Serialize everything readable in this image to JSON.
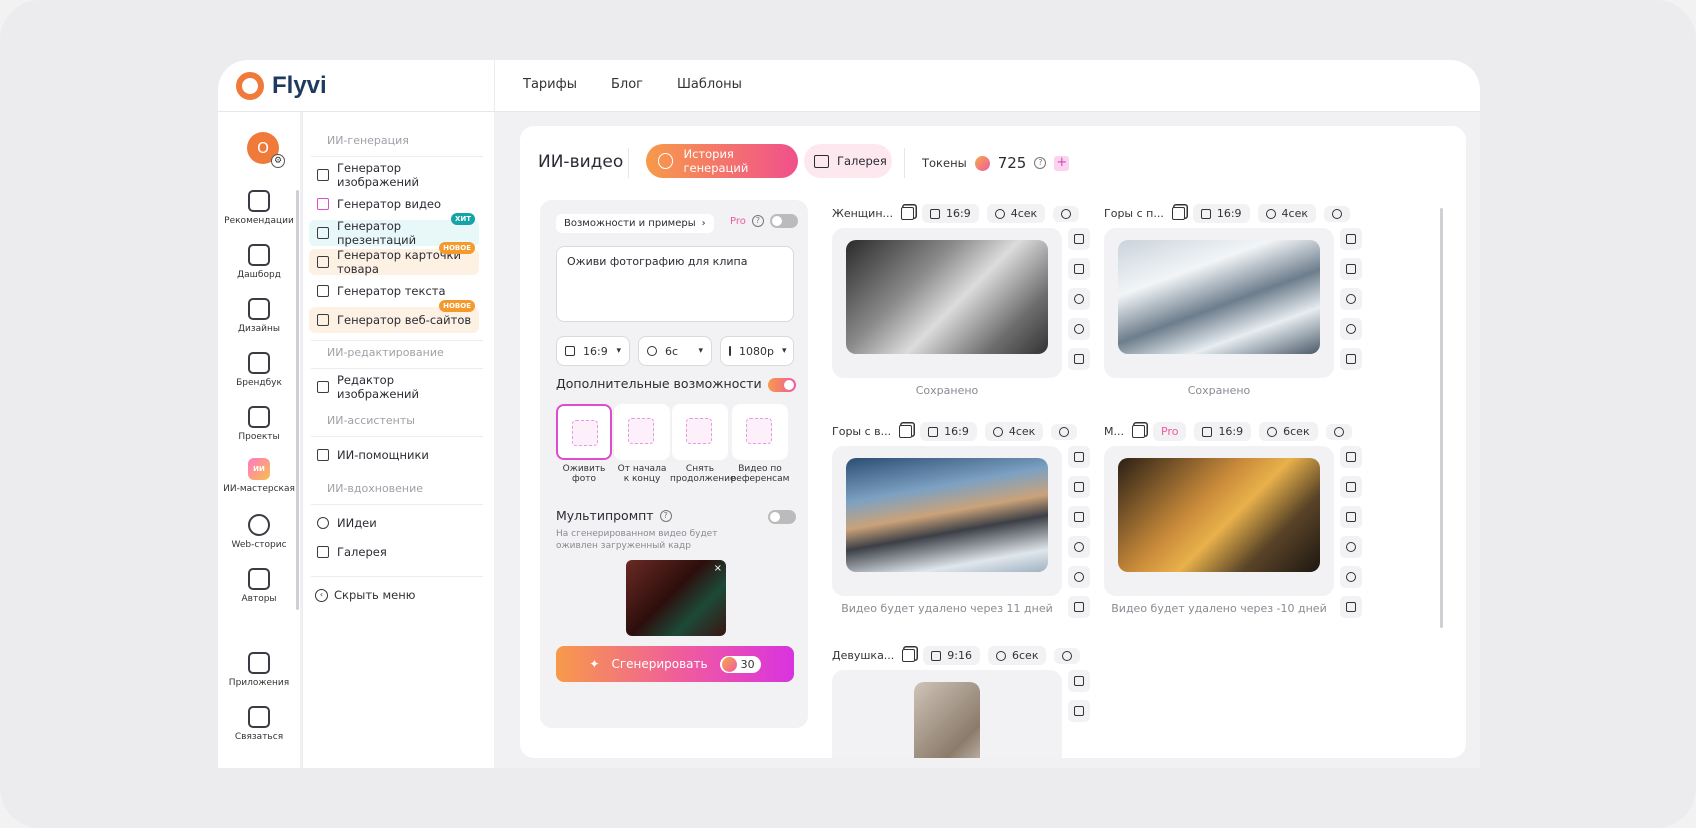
{
  "brand": {
    "name": "Flyvi"
  },
  "topnav": [
    "Тарифы",
    "Блог",
    "Шаблоны"
  ],
  "avatar": {
    "letter": "О"
  },
  "rail": [
    {
      "label": "Рекомендации",
      "icon": "recommendations-icon"
    },
    {
      "label": "Дашборд",
      "icon": "dashboard-icon"
    },
    {
      "label": "Дизайны",
      "icon": "designs-icon"
    },
    {
      "label": "Брендбук",
      "icon": "brandbook-icon"
    },
    {
      "label": "Проекты",
      "icon": "folder-icon"
    },
    {
      "label": "ИИ-мастерская",
      "icon": "ai-workshop-icon",
      "badge": "ИИ"
    },
    {
      "label": "Web-сторис",
      "icon": "web-stories-icon"
    },
    {
      "label": "Авторы",
      "icon": "authors-icon"
    },
    {
      "label": "Приложения",
      "icon": "apps-icon"
    },
    {
      "label": "Связаться",
      "icon": "chat-icon"
    }
  ],
  "menu": {
    "sections": {
      "gen": "ИИ-генерация",
      "edit": "ИИ-редактирование",
      "assist": "ИИ-ассистенты",
      "inspire": "ИИ-вдохновение"
    },
    "items": [
      {
        "label": "Генератор изображений"
      },
      {
        "label": "Генератор видео"
      },
      {
        "label": "Генератор презентаций",
        "badge": "ХИТ"
      },
      {
        "label": "Генератор карточки товара",
        "badge": "НОВОЕ"
      },
      {
        "label": "Генератор текста"
      },
      {
        "label": "Генератор веб-сайтов",
        "badge": "НОВОЕ"
      },
      {
        "label": "Редактор изображений"
      },
      {
        "label": "ИИ-помощники"
      },
      {
        "label": "ИИдеи"
      },
      {
        "label": "Галерея"
      }
    ],
    "hide": "Скрыть меню"
  },
  "header": {
    "title": "ИИ-видео",
    "history_btn": "История генераций",
    "gallery_btn": "Галерея",
    "tokens_label": "Токены",
    "tokens_value": "725",
    "help": "?",
    "plus": "+"
  },
  "panel": {
    "examples": "Возможности и примеры",
    "examples_chevron": "›",
    "pro": "Pro",
    "prompt": "Оживи фотографию для клипа",
    "ratio": "16:9",
    "duration": "6с",
    "resolution": "1080p",
    "extra_label": "Дополнительные возможности",
    "options": [
      {
        "l1": "Оживить",
        "l2": "фото"
      },
      {
        "l1": "От начала",
        "l2": "к концу"
      },
      {
        "l1": "Снять",
        "l2": "продолжение"
      },
      {
        "l1": "Видео по",
        "l2": "референсам"
      }
    ],
    "multiprompt": "Мультипромпт",
    "multiprompt_desc": "На сгенерированном видео будет оживлен загруженный кадр",
    "close": "×",
    "generate": "Сгенерировать",
    "generate_cost": "30"
  },
  "cards": [
    {
      "title": "Женщин...",
      "ratio": "16:9",
      "duration": "4сек",
      "caption": "Сохранено"
    },
    {
      "title": "Горы с п...",
      "ratio": "16:9",
      "duration": "4сек",
      "caption": "Сохранено"
    },
    {
      "title": "Горы с в...",
      "ratio": "16:9",
      "duration": "4сек",
      "caption": "Видео будет удалено через 11 дней"
    },
    {
      "title": "М...",
      "pro": "Pro",
      "ratio": "16:9",
      "duration": "6сек",
      "caption": "Видео будет удалено через -10 дней"
    },
    {
      "title": "Девушка...",
      "ratio": "9:16",
      "duration": "6сек",
      "caption": ""
    }
  ]
}
